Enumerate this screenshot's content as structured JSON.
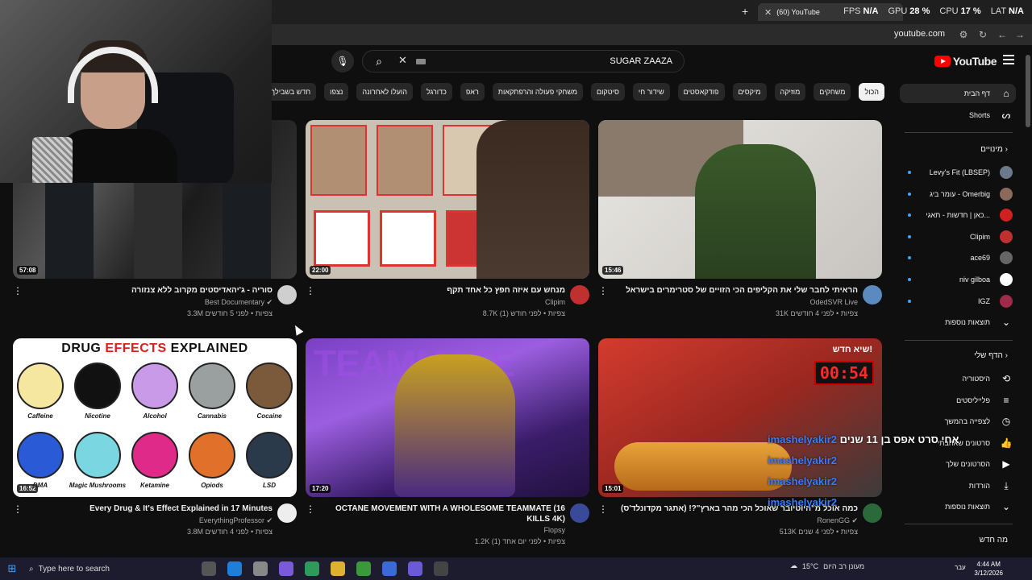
{
  "browser": {
    "tab_title": "(60) YouTube",
    "tab_close": "✕",
    "new_tab": "+",
    "url": "youtube.com",
    "overlay": [
      {
        "k": "FPS",
        "v": "N/A"
      },
      {
        "k": "GPU",
        "v": "28 %"
      },
      {
        "k": "CPU",
        "v": "17 %"
      },
      {
        "k": "LAT",
        "v": "N/A"
      }
    ]
  },
  "header": {
    "logo_text": "YouTube",
    "search_query": "SUGAR ZAAZA"
  },
  "chips": [
    "הכול",
    "משחקים",
    "מוזיקה",
    "מיקסים",
    "פודקאסטים",
    "שידור חי",
    "סיטקום",
    "משחקי פעולה והרפתקאות",
    "ראפ",
    "כדורגל",
    "הועלו לאחרונה",
    "נצפו",
    "חדש בשבילך"
  ],
  "sidebar": {
    "home": "דף הבית",
    "shorts": "Shorts",
    "subs_header": "מינויים",
    "subs": [
      {
        "name": "Levy's Fit (LBSEP)",
        "color": "#6a7a8a"
      },
      {
        "name": "עומר ביג - Omerbig",
        "color": "#8a6a5a"
      },
      {
        "name": "כאן | חדשות - תאגי...",
        "color": "#d02020"
      },
      {
        "name": "Clipim",
        "color": "#c03030"
      },
      {
        "name": "ace69",
        "color": "#666"
      },
      {
        "name": "niv gilboa",
        "color": "#ffffff"
      },
      {
        "name": "IGZ",
        "color": "#a02a4a"
      }
    ],
    "more_subs": "תוצאות נוספות",
    "you_header": "הדף שלי",
    "you": [
      {
        "label": "היסטוריה",
        "icon": "⟲"
      },
      {
        "label": "פלייליסטים",
        "icon": "≡"
      },
      {
        "label": "לצפייה בהמשך",
        "icon": "◷"
      },
      {
        "label": "סרטונים שאהבתי",
        "icon": "👍"
      },
      {
        "label": "הסרטונים שלך",
        "icon": "▶"
      },
      {
        "label": "הורדות",
        "icon": "⤓"
      },
      {
        "label": "תוצאות נוספות",
        "icon": "⌄"
      }
    ],
    "new_header": "מה חדש"
  },
  "videos": [
    {
      "title": "סוריה - ג'יהאדיסטים מקרוב ללא צנזורה",
      "channel": "Best Documentary",
      "views": "3.3M צפיות",
      "age": "לפני 5 חודשים",
      "duration": "57:08",
      "avatar": "#cfcfcf"
    },
    {
      "title": "מנחש עם איזה חפץ כל אחד תקף",
      "channel": "Clipim",
      "views": "8.7K צפיות",
      "age": "לפני חודש (1)",
      "duration": "22:00",
      "avatar": "#c03030"
    },
    {
      "title": "הראיתי לחבר שלי את הקליפים הכי הזויים של סטרימרים בישראל",
      "channel": "OdedSVR Live",
      "views": "31K צפיות",
      "age": "לפני 4 חודשים",
      "duration": "15:46",
      "avatar": "#5a8ac0"
    },
    {
      "title": "Every Drug & It's Effect Explained in 17 Minutes",
      "channel": "EverythingProfessor",
      "views": "3.8M צפיות",
      "age": "לפני 4 חודשים",
      "duration": "16:52",
      "avatar": "#eeeeee"
    },
    {
      "title": "OCTANE MOVEMENT WITH A WHOLESOME TEAMMATE (16 KILLS 4K)",
      "channel": "Flopsy",
      "views": "1.2K צפיות",
      "age": "לפני יום אחד (1)",
      "duration": "17:20",
      "avatar": "#3a4a9a"
    },
    {
      "title": "כמה אוכל מ\"היוטיובר שאוכל הכי מהר בארץ\"?! (אתגר מקדונלד'ס)",
      "channel": "RonenGG",
      "views": "513K צפיות",
      "age": "לפני 4 שנים",
      "duration": "15:01",
      "avatar": "#2a6a3a"
    }
  ],
  "thumb_text": {
    "drug_title_a": "DRUG ",
    "drug_title_b": "EFFECTS",
    "drug_title_c": " EXPLAINED",
    "drugs": [
      "Caffeine",
      "Nicotine",
      "Alcohol",
      "Cannabis",
      "Cocaine",
      "DMA",
      "Magic Mushrooms",
      "Ketamine",
      "Opiods",
      "LSD"
    ],
    "teammate": "TEAMMATE",
    "mc_tag": "שיא חדש!",
    "mc_timer": "00:54"
  },
  "chat": [
    {
      "user": "imashelyakir2",
      "msg": " אחי סרט אפס בן 11 שנים"
    },
    {
      "user": "imashelyakir2",
      "msg": ""
    },
    {
      "user": "imashelyakir2",
      "msg": ""
    },
    {
      "user": "imashelyakir2",
      "msg": ""
    }
  ],
  "taskbar": {
    "search_placeholder": "Type here to search",
    "weather_temp": "15°C",
    "weather_text": "מעונן רב היום",
    "lang": "עבר",
    "time": "4:44 AM",
    "date": "3/12/2026"
  },
  "colors": {
    "accent": "#ff0000",
    "link": "#3ea6ff",
    "bg": "#0f0f0f"
  }
}
